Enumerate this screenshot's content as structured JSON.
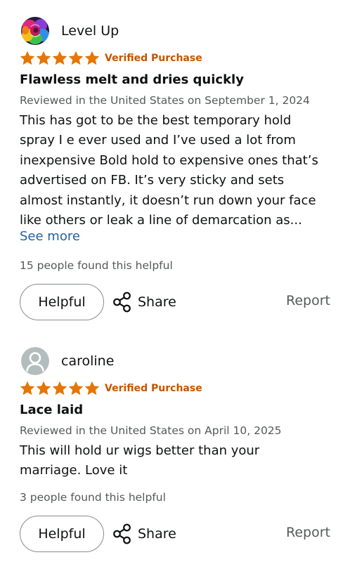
{
  "theme": {
    "star_color": "#e77600",
    "verified_color": "#c45500",
    "link_color": "#2162a1",
    "muted_text_color": "#565959"
  },
  "reviews": [
    {
      "reviewer": {
        "name": "Level Up",
        "avatar": "rainbow-rose-photo"
      },
      "rating": 5,
      "rating_max": 5,
      "verified_label": "Verified Purchase",
      "title": "Flawless melt and dries quickly",
      "date_line": "Reviewed in the United States on September 1, 2024",
      "body_lines": [
        "This has got to be the best temporary hold",
        "spray I e ever used and I’ve used a lot from",
        "inexpensive Bold hold to expensive ones that’s",
        "advertised on FB. It’s very sticky and sets",
        "almost instantly, it doesn’t run down your face",
        "like others or leak a line of demarcation as..."
      ],
      "see_more_label": "See more",
      "helpful_count_text": "15 people found this helpful",
      "helpful_button_label": "Helpful",
      "share_label": "Share",
      "share_icon": "share-icon",
      "report_label": "Report"
    },
    {
      "reviewer": {
        "name": "caroline",
        "avatar": "default-person-icon"
      },
      "rating": 5,
      "rating_max": 5,
      "verified_label": "Verified Purchase",
      "title": "Lace laid",
      "date_line": "Reviewed in the United States on April 10, 2025",
      "body_lines": [
        "This will hold ur wigs better than your",
        "marriage. Love it"
      ],
      "helpful_count_text": "3 people found this helpful",
      "helpful_button_label": "Helpful",
      "share_label": "Share",
      "share_icon": "share-icon",
      "report_label": "Report"
    }
  ]
}
